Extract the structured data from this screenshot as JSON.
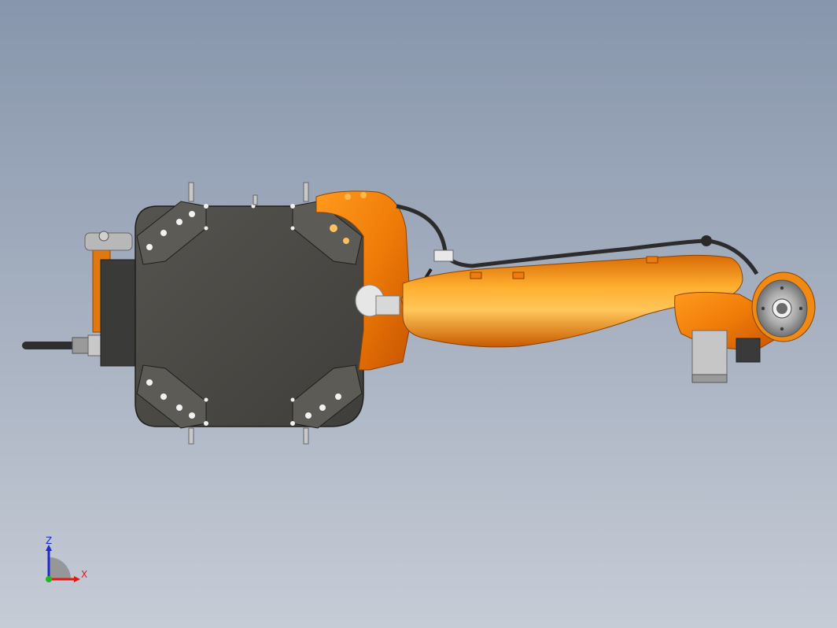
{
  "viewport": {
    "title": "",
    "model": "industrial-robot-arm"
  },
  "triad": {
    "z_label": "Z",
    "x_label": "X",
    "colors": {
      "z": "#1a2bd6",
      "x": "#e01818",
      "y": "#1fb81f"
    }
  },
  "colors": {
    "orange": "#f08a12",
    "orange_light": "#ffbe4a",
    "base_plate": "#4a4a46",
    "background_top": "#8796ac",
    "background_bottom": "#c6ccd6"
  }
}
